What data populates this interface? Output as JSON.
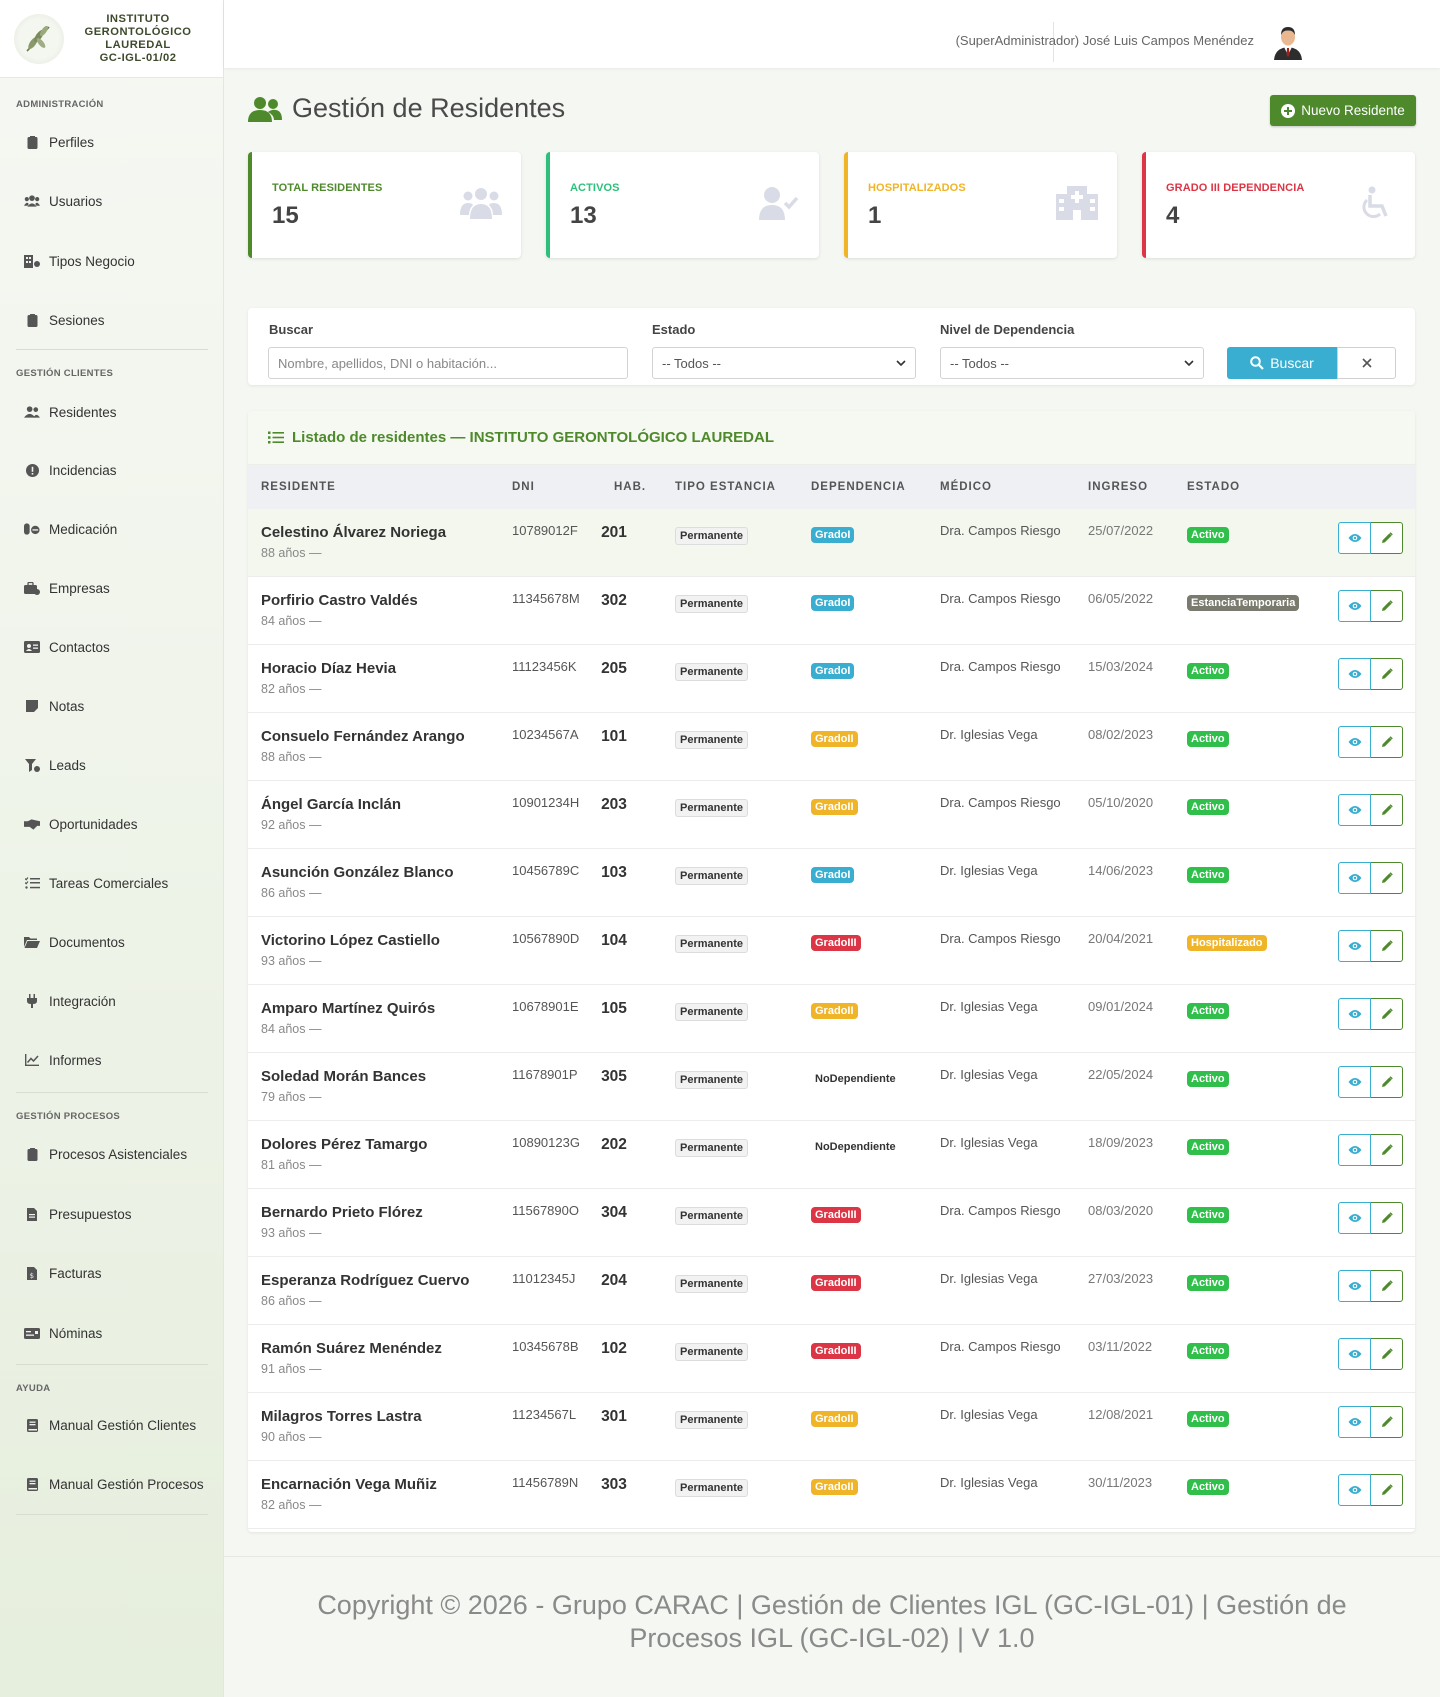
{
  "brand": {
    "line1": "INSTITUTO",
    "line2": "GERONTOLÓGICO",
    "line3": "LAUREDAL",
    "line4": "GC-IGL-01/02"
  },
  "sidebar": {
    "sections": [
      "ADMINISTRACIÓN",
      "GESTIÓN CLIENTES",
      "GESTIÓN PROCESOS",
      "AYUDA"
    ],
    "items": [
      {
        "label": "Perfiles",
        "icon": "id-badge-icon"
      },
      {
        "label": "Usuarios",
        "icon": "users-icon"
      },
      {
        "label": "Tipos Negocio",
        "icon": "building-icon"
      },
      {
        "label": "Sesiones",
        "icon": "clipboard-icon"
      },
      {
        "label": "Residentes",
        "icon": "users-icon"
      },
      {
        "label": "Incidencias",
        "icon": "exclamation-circle-icon"
      },
      {
        "label": "Medicación",
        "icon": "pills-icon"
      },
      {
        "label": "Empresas",
        "icon": "briefcase-icon"
      },
      {
        "label": "Contactos",
        "icon": "address-card-icon"
      },
      {
        "label": "Notas",
        "icon": "sticky-note-icon"
      },
      {
        "label": "Leads",
        "icon": "funnel-icon"
      },
      {
        "label": "Oportunidades",
        "icon": "handshake-icon"
      },
      {
        "label": "Tareas Comerciales",
        "icon": "tasks-icon"
      },
      {
        "label": "Documentos",
        "icon": "folder-open-icon"
      },
      {
        "label": "Integración",
        "icon": "plug-icon"
      },
      {
        "label": "Informes",
        "icon": "chart-line-icon"
      },
      {
        "label": "Procesos Asistenciales",
        "icon": "clipboard-icon"
      },
      {
        "label": "Presupuestos",
        "icon": "file-invoice-icon"
      },
      {
        "label": "Facturas",
        "icon": "file-invoice-dollar-icon"
      },
      {
        "label": "Nóminas",
        "icon": "money-check-icon"
      },
      {
        "label": "Manual Gestión Clientes",
        "icon": "book-icon"
      },
      {
        "label": "Manual Gestión Procesos",
        "icon": "book-icon"
      }
    ]
  },
  "header": {
    "user": "(SuperAdministrador) José Luis Campos Menéndez"
  },
  "page": {
    "title": "Gestión de Residentes",
    "new_button": "Nuevo Residente"
  },
  "stats": [
    {
      "label": "TOTAL RESIDENTES",
      "value": "15",
      "color": "#4e8a2c",
      "icon": "users-icon"
    },
    {
      "label": "ACTIVOS",
      "value": "13",
      "color": "#2fbf7c",
      "icon": "user-check-icon"
    },
    {
      "label": "HOSPITALIZADOS",
      "value": "1",
      "color": "#f0b429",
      "icon": "hospital-icon"
    },
    {
      "label": "GRADO III DEPENDENCIA",
      "value": "4",
      "color": "#dc3545",
      "icon": "wheelchair-icon"
    }
  ],
  "filters": {
    "search_label": "Buscar",
    "search_placeholder": "Nombre, apellidos, DNI o habitación...",
    "estado_label": "Estado",
    "estado_value": "-- Todos --",
    "dependencia_label": "Nivel de Dependencia",
    "dependencia_value": "-- Todos --",
    "search_button": "Buscar"
  },
  "list": {
    "title": "Listado de residentes — INSTITUTO GERONTOLÓGICO LAUREDAL",
    "columns": [
      "RESIDENTE",
      "DNI",
      "HAB.",
      "TIPO ESTANCIA",
      "DEPENDENCIA",
      "MÉDICO",
      "INGRESO",
      "ESTADO"
    ],
    "rows": [
      {
        "name": "Celestino Álvarez Noriega",
        "age": "88 años —",
        "dni": "10789012F",
        "hab": "201",
        "tipo": "Permanente",
        "dep": "GradoI",
        "dep_color": "#3aaed0",
        "medico": "Dra. Campos Riesgo",
        "ingreso": "25/07/2022",
        "estado": "Activo",
        "estado_color": "#2fbf4a"
      },
      {
        "name": "Porfirio Castro Valdés",
        "age": "84 años —",
        "dni": "11345678M",
        "hab": "302",
        "tipo": "Permanente",
        "dep": "GradoI",
        "dep_color": "#3aaed0",
        "medico": "Dra. Campos Riesgo",
        "ingreso": "06/05/2022",
        "estado": "EstanciaTemporaria",
        "estado_color": "#7a7a6e"
      },
      {
        "name": "Horacio Díaz Hevia",
        "age": "82 años —",
        "dni": "11123456K",
        "hab": "205",
        "tipo": "Permanente",
        "dep": "GradoI",
        "dep_color": "#3aaed0",
        "medico": "Dra. Campos Riesgo",
        "ingreso": "15/03/2024",
        "estado": "Activo",
        "estado_color": "#2fbf4a"
      },
      {
        "name": "Consuelo Fernández Arango",
        "age": "88 años —",
        "dni": "10234567A",
        "hab": "101",
        "tipo": "Permanente",
        "dep": "GradoII",
        "dep_color": "#f0b429",
        "medico": "Dr. Iglesias Vega",
        "ingreso": "08/02/2023",
        "estado": "Activo",
        "estado_color": "#2fbf4a"
      },
      {
        "name": "Ángel García Inclán",
        "age": "92 años —",
        "dni": "10901234H",
        "hab": "203",
        "tipo": "Permanente",
        "dep": "GradoII",
        "dep_color": "#f0b429",
        "medico": "Dra. Campos Riesgo",
        "ingreso": "05/10/2020",
        "estado": "Activo",
        "estado_color": "#2fbf4a"
      },
      {
        "name": "Asunción González Blanco",
        "age": "86 años —",
        "dni": "10456789C",
        "hab": "103",
        "tipo": "Permanente",
        "dep": "GradoI",
        "dep_color": "#3aaed0",
        "medico": "Dr. Iglesias Vega",
        "ingreso": "14/06/2023",
        "estado": "Activo",
        "estado_color": "#2fbf4a"
      },
      {
        "name": "Victorino López Castiello",
        "age": "93 años —",
        "dni": "10567890D",
        "hab": "104",
        "tipo": "Permanente",
        "dep": "GradoIII",
        "dep_color": "#dc3545",
        "medico": "Dra. Campos Riesgo",
        "ingreso": "20/04/2021",
        "estado": "Hospitalizado",
        "estado_color": "#f0b429"
      },
      {
        "name": "Amparo Martínez Quirós",
        "age": "84 años —",
        "dni": "10678901E",
        "hab": "105",
        "tipo": "Permanente",
        "dep": "GradoII",
        "dep_color": "#f0b429",
        "medico": "Dr. Iglesias Vega",
        "ingreso": "09/01/2024",
        "estado": "Activo",
        "estado_color": "#2fbf4a"
      },
      {
        "name": "Soledad Morán Bances",
        "age": "79 años —",
        "dni": "11678901P",
        "hab": "305",
        "tipo": "Permanente",
        "dep": "NoDependiente",
        "dep_color": "",
        "medico": "Dr. Iglesias Vega",
        "ingreso": "22/05/2024",
        "estado": "Activo",
        "estado_color": "#2fbf4a"
      },
      {
        "name": "Dolores Pérez Tamargo",
        "age": "81 años —",
        "dni": "10890123G",
        "hab": "202",
        "tipo": "Permanente",
        "dep": "NoDependiente",
        "dep_color": "",
        "medico": "Dr. Iglesias Vega",
        "ingreso": "18/09/2023",
        "estado": "Activo",
        "estado_color": "#2fbf4a"
      },
      {
        "name": "Bernardo Prieto Flórez",
        "age": "93 años —",
        "dni": "11567890O",
        "hab": "304",
        "tipo": "Permanente",
        "dep": "GradoIII",
        "dep_color": "#dc3545",
        "medico": "Dra. Campos Riesgo",
        "ingreso": "08/03/2020",
        "estado": "Activo",
        "estado_color": "#2fbf4a"
      },
      {
        "name": "Esperanza Rodríguez Cuervo",
        "age": "86 años —",
        "dni": "11012345J",
        "hab": "204",
        "tipo": "Permanente",
        "dep": "GradoIII",
        "dep_color": "#dc3545",
        "medico": "Dr. Iglesias Vega",
        "ingreso": "27/03/2023",
        "estado": "Activo",
        "estado_color": "#2fbf4a"
      },
      {
        "name": "Ramón Suárez Menéndez",
        "age": "91 años —",
        "dni": "10345678B",
        "hab": "102",
        "tipo": "Permanente",
        "dep": "GradoIII",
        "dep_color": "#dc3545",
        "medico": "Dra. Campos Riesgo",
        "ingreso": "03/11/2022",
        "estado": "Activo",
        "estado_color": "#2fbf4a"
      },
      {
        "name": "Milagros Torres Lastra",
        "age": "90 años —",
        "dni": "11234567L",
        "hab": "301",
        "tipo": "Permanente",
        "dep": "GradoII",
        "dep_color": "#f0b429",
        "medico": "Dr. Iglesias Vega",
        "ingreso": "12/08/2021",
        "estado": "Activo",
        "estado_color": "#2fbf4a"
      },
      {
        "name": "Encarnación Vega Muñiz",
        "age": "82 años —",
        "dni": "11456789N",
        "hab": "303",
        "tipo": "Permanente",
        "dep": "GradoII",
        "dep_color": "#f0b429",
        "medico": "Dr. Iglesias Vega",
        "ingreso": "30/11/2023",
        "estado": "Activo",
        "estado_color": "#2fbf4a"
      }
    ]
  },
  "footer": {
    "line1": "Copyright © 2026 - Grupo CARAC | Gestión de Clientes IGL (GC-IGL-01) | Gestión de",
    "line2": "Procesos IGL (GC-IGL-02) | V 1.0"
  }
}
